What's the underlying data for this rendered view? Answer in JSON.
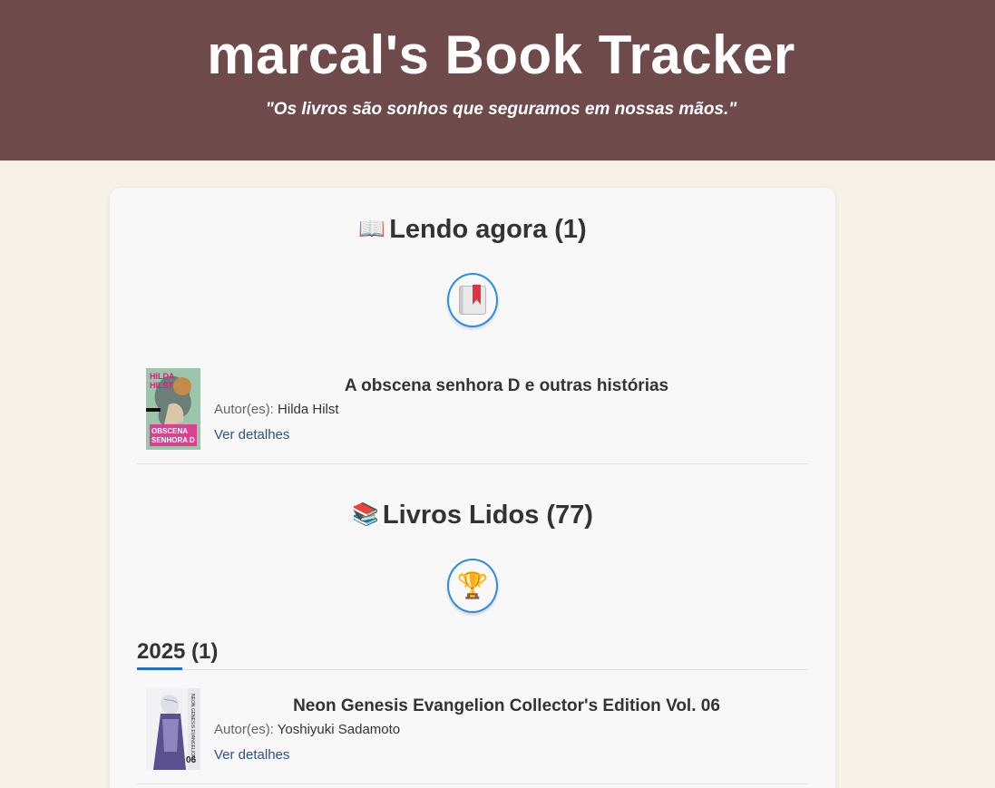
{
  "header": {
    "title": "marcal's Book Tracker",
    "quote": "\"Os livros são sonhos que seguramos em nossas mãos.\""
  },
  "reading": {
    "emoji": "📖",
    "title": "Lendo agora (1)",
    "button_icon": "bookmark-book-icon",
    "books": [
      {
        "title": "A obscena senhora D e outras histórias",
        "author_label": "Autor(es):",
        "author": "Hilda Hilst",
        "details_label": "Ver detalhes",
        "cover_text_top": "HILDA HILST",
        "cover_text_bottom": "OBSCENA SENHORA D"
      }
    ]
  },
  "read": {
    "emoji": "📚",
    "title": "Livros Lidos (77)",
    "button_icon": "trophy-icon",
    "years": [
      {
        "label": "2025 (1)",
        "books": [
          {
            "title": "Neon Genesis Evangelion Collector's Edition Vol. 06",
            "author_label": "Autor(es):",
            "author": "Yoshiyuki Sadamoto",
            "details_label": "Ver detalhes",
            "cover_text": "06"
          }
        ]
      }
    ]
  },
  "colors": {
    "header_bg": "#6e4a4b",
    "page_bg": "#f6f2e8",
    "accent": "#2a8ee3",
    "link": "#2f4f89"
  }
}
